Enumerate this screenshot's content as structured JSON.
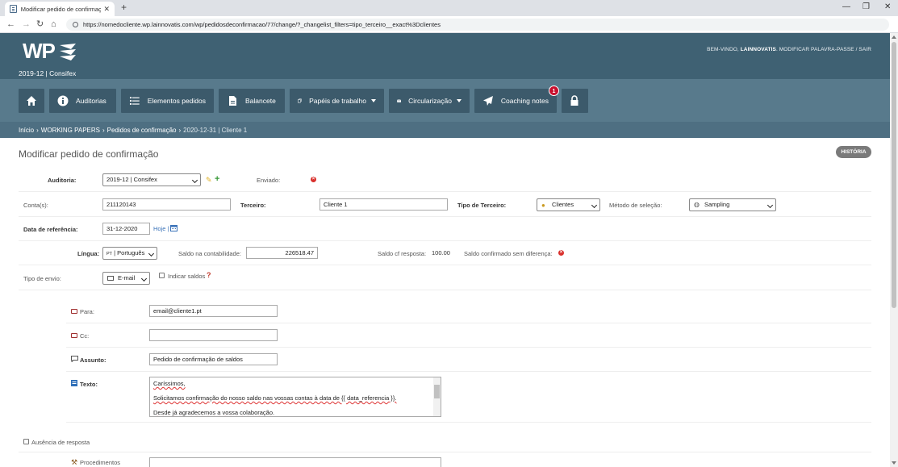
{
  "browser": {
    "tab_title": "Modificar pedido de confirmaçã",
    "url": "https://nomedocliente.wp.lainnovatis.com/wp/pedidosdeconfirmacao/77/change/?_changelist_filters=tipo_terceiro__exact%3Dclientes"
  },
  "header": {
    "logo": "WP",
    "welcome": "BEM-VINDO,",
    "user": "LAINNOVATIS",
    "actions": ". MODIFICAR PALAVRA-PASSE / SAIR",
    "project": "2019-12 | Consifex"
  },
  "nav": {
    "items": [
      {
        "label": ""
      },
      {
        "label": "Auditorias"
      },
      {
        "label": "Elementos pedidos"
      },
      {
        "label": "Balancete"
      },
      {
        "label": "Papéis de trabalho"
      },
      {
        "label": "Circularização"
      },
      {
        "label": "Coaching notes"
      },
      {
        "label": ""
      }
    ],
    "coaching_badge": "1"
  },
  "breadcrumb": {
    "home": "Início",
    "section": "WORKING PAPERS",
    "list": "Pedidos de confirmação",
    "current": "2020-12-31 | Cliente 1"
  },
  "page": {
    "title": "Modificar pedido de confirmação",
    "history_button": "HISTÓRIA"
  },
  "form": {
    "auditoria_label": "Auditoria:",
    "auditoria_value": "2019-12 | Consifex",
    "enviado_label": "Enviado:",
    "contas_label": "Conta(s):",
    "contas_value": "211120143",
    "terceiro_label": "Terceiro:",
    "terceiro_value": "Cliente 1",
    "tipo_terceiro_label": "Tipo de Terceiro:",
    "tipo_terceiro_value": "Clientes",
    "metodo_label": "Método de seleção:",
    "metodo_value": "Sampling",
    "data_ref_label": "Data de referência:",
    "data_ref_value": "31-12-2020",
    "hoje_link": "Hoje |",
    "lingua_label": "Língua:",
    "lingua_prefix": "PT",
    "lingua_value": "| Português",
    "saldo_cont_label": "Saldo na contabilidade:",
    "saldo_cont_value": "226518.47",
    "saldo_cf_label": "Saldo cf resposta:",
    "saldo_cf_value": "100.00",
    "saldo_sem_dif_label": "Saldo confirmado sem diferença:",
    "tipo_envio_label": "Tipo de envio:",
    "tipo_envio_value": "E-mail",
    "indicar_saldos_label": "Indicar saldos",
    "para_label": "Para:",
    "para_value": "email@cliente1.pt",
    "cc_label": "Cc:",
    "cc_value": "",
    "assunto_label": "Assunto:",
    "assunto_value": "Pedido de confirmação de saldos",
    "texto_label": "Texto:",
    "texto_line1": "Caríssimos,",
    "texto_line2": "Solicitamos confirmação do nosso saldo nas vossas contas à data de {{ data_referencia }}.",
    "texto_line3": "Desde já agradecemos a vossa colaboração.",
    "ausencia_label": "Ausência de resposta",
    "procedimentos_label": "Procedimentos"
  },
  "colors": {
    "header_dark": "#3f6173",
    "header_mid": "#587a8c",
    "button": "#3c5a6b",
    "badge": "#c8102e",
    "error": "#d9302c",
    "link": "#3b73b9"
  }
}
